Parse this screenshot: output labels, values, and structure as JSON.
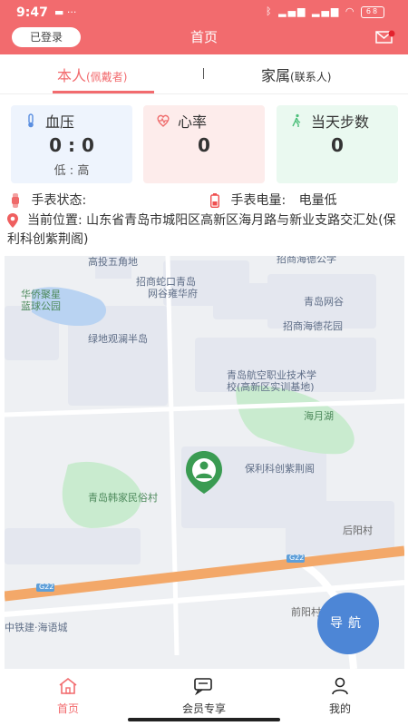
{
  "status_bar": {
    "time": "9:47",
    "left_icons": [
      "folder-icon",
      "more-icon"
    ],
    "right_icons": [
      "bluetooth-icon",
      "signal-icon",
      "signal-icon",
      "wifi-icon"
    ],
    "battery": "68"
  },
  "header": {
    "login_label": "已登录",
    "title": "首页"
  },
  "tabs": [
    {
      "label": "本人",
      "sub": "(佩戴者)",
      "active": true
    },
    {
      "label": "家属",
      "sub": "(联系人)",
      "active": false
    }
  ],
  "cards": {
    "blood_pressure": {
      "label": "血压",
      "value": "0 : 0",
      "sub": "低 : 高"
    },
    "heart_rate": {
      "label": "心率",
      "value": "0"
    },
    "steps": {
      "label": "当天步数",
      "value": "0"
    }
  },
  "watch": {
    "status_label": "手表状态:",
    "status_value": "",
    "battery_label": "手表电量:",
    "battery_value": "电量低"
  },
  "location": {
    "label": "当前位置:",
    "address": "山东省青岛市城阳区高新区海月路与新业支路交汇处(保利科创紫荆阁)"
  },
  "map": {
    "pois": [
      "高投五角地",
      "招商海德公学",
      "招商蛇口青岛",
      "网谷雍华府",
      "华侨聚星",
      "蓝球公园",
      "青岛网谷",
      "招商海德花园",
      "绿地观澜半岛",
      "青岛航空职业技术学",
      "校(高新区实训基地)",
      "海月湖",
      "保利科创紫荆阁",
      "青岛韩家民俗村",
      "后阳村",
      "G22",
      "G22",
      "前阳村",
      "中铁建·海语城"
    ],
    "nav_button": "导航"
  },
  "bottom_nav": [
    {
      "label": "首页",
      "icon": "home-icon",
      "active": true
    },
    {
      "label": "会员专享",
      "icon": "chat-icon",
      "active": false
    },
    {
      "label": "我的",
      "icon": "person-icon",
      "active": false
    }
  ],
  "colors": {
    "brand": "#f26b6e",
    "nav_button": "#4d86d6",
    "map_green": "#c9ebcf",
    "highway": "#f3a869"
  }
}
